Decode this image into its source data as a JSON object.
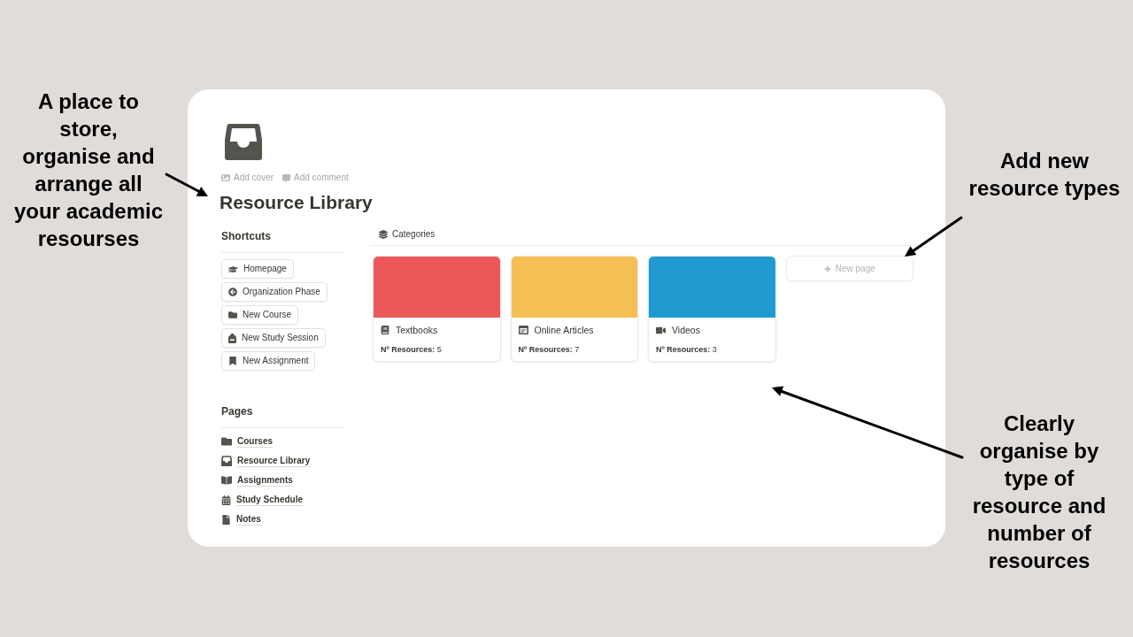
{
  "left_callout": {
    "text": "A place to store, organise and arrange all your academic resourses"
  },
  "page": {
    "actions": [
      "Add cover",
      "Add comment"
    ],
    "title": "Resource Library",
    "shortcuts": {
      "heading": "Shortcuts",
      "buttons": [
        "Homepage",
        "Organization Phase",
        "New Course",
        "New Study Session",
        "New Assignment"
      ]
    },
    "pages": {
      "heading": "Pages",
      "links": [
        "Courses",
        "Resource Library",
        "Assignments",
        "Study Schedule",
        "Notes"
      ]
    },
    "categories": {
      "heading": "Categories",
      "cards": [
        {
          "title": "Textbooks",
          "color": "#ec5858",
          "count": "**Nº Resources:** 5"
        },
        {
          "title": "Online Articles",
          "color": "#f6bf53",
          "count": "**Nº Resources:** 7"
        },
        {
          "title": "Videos",
          "color": "#1f9bd1",
          "count": "**Nº Resources:** 3"
        }
      ],
      "new_page_button": "New page"
    }
  },
  "right_callouts": [
    {
      "text": "Add new resource types"
    },
    {
      "text": "Clearly organise by type of resource and number of resources"
    }
  ]
}
